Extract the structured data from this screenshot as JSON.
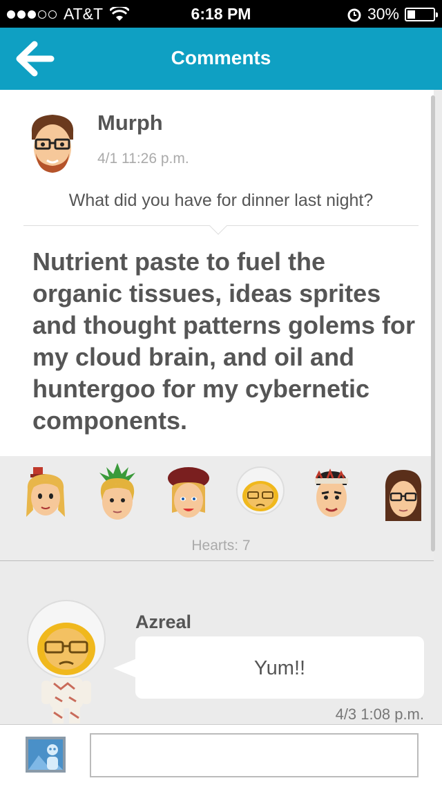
{
  "status_bar": {
    "carrier": "AT&T",
    "time": "6:18 PM",
    "battery": "30%",
    "battery_level": 0.3,
    "signal_bars": 3,
    "signal_total": 5
  },
  "nav": {
    "title": "Comments"
  },
  "post": {
    "author": "Murph",
    "timestamp": "4/1 11:26 p.m.",
    "question": "What did you have for dinner last night?",
    "answer": "Nutrient paste to fuel the organic tissues, ideas sprites and thought patterns golems for my cloud brain, and oil and huntergoo for my cybernetic components."
  },
  "hearts": {
    "label": "Hearts: 7",
    "avatars": [
      "blonde-pigtails-hat-avatar",
      "pineapple-hair-avatar",
      "beret-avatar",
      "astronaut-helmet-avatar",
      "headband-avatar",
      "brown-hair-glasses-avatar"
    ]
  },
  "comments": [
    {
      "author": "Azreal",
      "text": "Yum!!",
      "timestamp": "4/3 1:08 p.m."
    }
  ],
  "input": {
    "placeholder": ""
  },
  "colors": {
    "accent": "#0fa0c3",
    "background": "#ebebeb",
    "text": "#555555"
  }
}
